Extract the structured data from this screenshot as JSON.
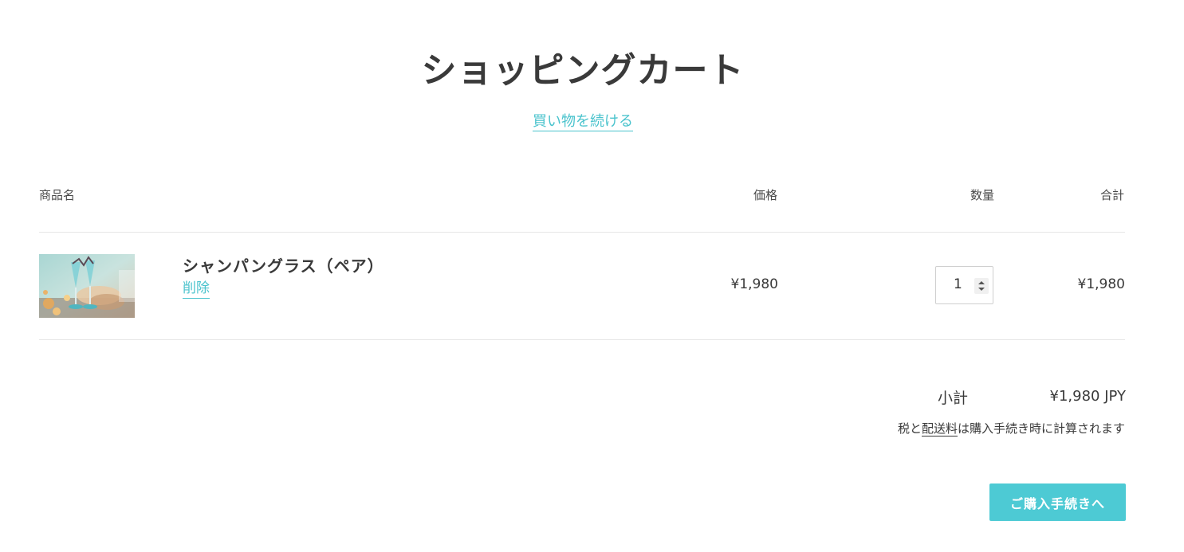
{
  "header": {
    "title": "ショッピングカート",
    "continue_shopping": "買い物を続ける"
  },
  "table": {
    "columns": {
      "product": "商品名",
      "price": "価格",
      "quantity": "数量",
      "total": "合計"
    },
    "rows": [
      {
        "name": "シャンパングラス（ペア）",
        "remove": "削除",
        "price": "¥1,980",
        "quantity": "1",
        "total": "¥1,980",
        "image": "champagne-glasses-photo"
      }
    ]
  },
  "summary": {
    "subtotal_label": "小計",
    "subtotal_value": "¥1,980 JPY",
    "tax_prefix": "税と",
    "shipping_link": "配送料",
    "tax_suffix": "は購入手続き時に計算されます",
    "checkout_label": "ご購入手続きへ"
  },
  "colors": {
    "accent": "#4dcad4",
    "link": "#4ac3cd",
    "text": "#3a3a3a",
    "divider": "#e6e6e6"
  }
}
